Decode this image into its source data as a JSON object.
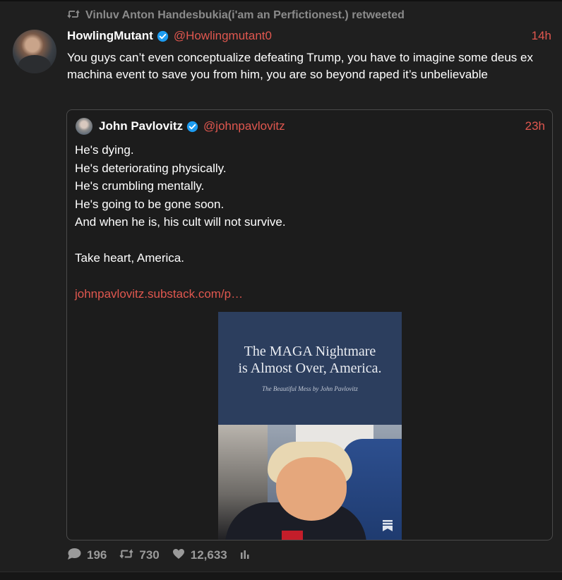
{
  "retweet_bar": {
    "text": "Vinluv Anton Handesbukia(i'am an Perfictionest.) retweeted"
  },
  "tweet": {
    "author_name": "HowlingMutant",
    "author_handle": "@Howlingmutant0",
    "time": "14h",
    "text": "You guys can’t even conceptualize defeating Trump, you have to imagine some deus ex machina event to save you from him, you are so beyond raped it’s unbelievable"
  },
  "quoted_tweet": {
    "author_name": "John Pavlovitz",
    "author_handle": "@johnpavlovitz",
    "time": "23h",
    "lines": [
      "He's dying.",
      "He's deteriorating physically.",
      "He's crumbling mentally.",
      "He's going to be gone soon.",
      "And when he is, his cult will not survive.",
      "",
      "Take heart, America.",
      ""
    ],
    "link": "johnpavlovitz.substack.com/p…",
    "card": {
      "title_line1": "The MAGA Nightmare",
      "title_line2": "is Almost Over, America.",
      "subtitle": "The Beautiful Mess by John Pavlovitz"
    }
  },
  "actions": {
    "replies": "196",
    "retweets": "730",
    "likes": "12,633"
  },
  "colors": {
    "background": "#1f1f1f",
    "accent": "#e0574f",
    "verified": "#1d9bf0",
    "muted": "#9a9a9a"
  },
  "icons": [
    "retweet-icon",
    "verified-icon",
    "reply-icon",
    "heart-icon",
    "stats-icon",
    "bookmark-icon"
  ]
}
